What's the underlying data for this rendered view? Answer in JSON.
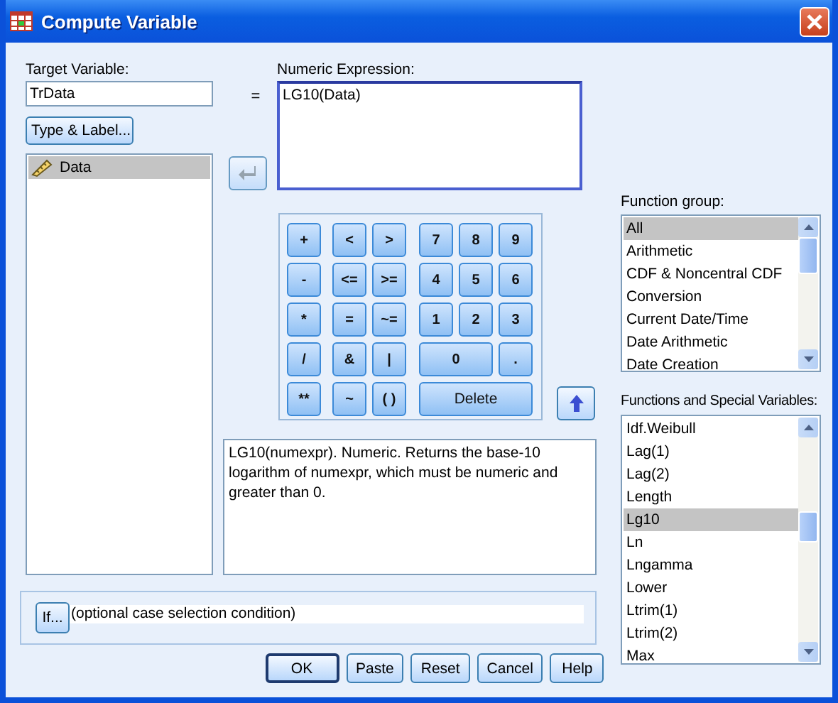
{
  "window": {
    "title": "Compute Variable"
  },
  "target_variable": {
    "label": "Target Variable:",
    "value": "TrData"
  },
  "equals": "=",
  "type_label_button": "Type & Label...",
  "variables": [
    {
      "name": "Data",
      "selected": true
    }
  ],
  "numeric_expression": {
    "label": "Numeric Expression:",
    "value": "LG10(Data)"
  },
  "keypad": {
    "operators": [
      {
        "label": "+"
      },
      {
        "label": "-"
      },
      {
        "label": "*"
      },
      {
        "label": "/"
      },
      {
        "label": "**"
      }
    ],
    "relations": [
      {
        "label": "<"
      },
      {
        "label": ">"
      },
      {
        "label": "<="
      },
      {
        "label": ">="
      },
      {
        "label": "="
      },
      {
        "label": "~="
      },
      {
        "label": "&"
      },
      {
        "label": "|"
      },
      {
        "label": "~"
      },
      {
        "label": "( )"
      }
    ],
    "digits": [
      {
        "label": "7",
        "kind": "single"
      },
      {
        "label": "8",
        "kind": "single"
      },
      {
        "label": "9",
        "kind": "single"
      },
      {
        "label": "4",
        "kind": "single"
      },
      {
        "label": "5",
        "kind": "single"
      },
      {
        "label": "6",
        "kind": "single"
      },
      {
        "label": "1",
        "kind": "single"
      },
      {
        "label": "2",
        "kind": "single"
      },
      {
        "label": "3",
        "kind": "single"
      },
      {
        "label": "0",
        "kind": "double"
      },
      {
        "label": ".",
        "kind": "single"
      },
      {
        "label": "Delete",
        "kind": "triple"
      }
    ]
  },
  "description": "LG10(numexpr). Numeric. Returns the base-10 logarithm of numexpr, which must be numeric and greater than 0.",
  "function_group": {
    "label": "Function group:",
    "items": [
      {
        "name": "All",
        "selected": true
      },
      {
        "name": "Arithmetic",
        "selected": false
      },
      {
        "name": "CDF & Noncentral CDF",
        "selected": false
      },
      {
        "name": "Conversion",
        "selected": false
      },
      {
        "name": "Current Date/Time",
        "selected": false
      },
      {
        "name": "Date Arithmetic",
        "selected": false
      },
      {
        "name": "Date Creation",
        "selected": false
      }
    ]
  },
  "functions": {
    "label": "Functions and Special Variables:",
    "items": [
      {
        "name": "Idf.Weibull",
        "selected": false
      },
      {
        "name": "Lag(1)",
        "selected": false
      },
      {
        "name": "Lag(2)",
        "selected": false
      },
      {
        "name": "Length",
        "selected": false
      },
      {
        "name": "Lg10",
        "selected": true
      },
      {
        "name": "Ln",
        "selected": false
      },
      {
        "name": "Lngamma",
        "selected": false
      },
      {
        "name": "Lower",
        "selected": false
      },
      {
        "name": "Ltrim(1)",
        "selected": false
      },
      {
        "name": "Ltrim(2)",
        "selected": false
      },
      {
        "name": "Max",
        "selected": false
      }
    ]
  },
  "if_button": "If...",
  "condition": "(optional case selection condition)",
  "buttons": [
    {
      "label": "OK",
      "kind": "default"
    },
    {
      "label": "Paste",
      "kind": "normal"
    },
    {
      "label": "Reset",
      "kind": "normal"
    },
    {
      "label": "Cancel",
      "kind": "normal"
    },
    {
      "label": "Help",
      "kind": "normal"
    }
  ]
}
